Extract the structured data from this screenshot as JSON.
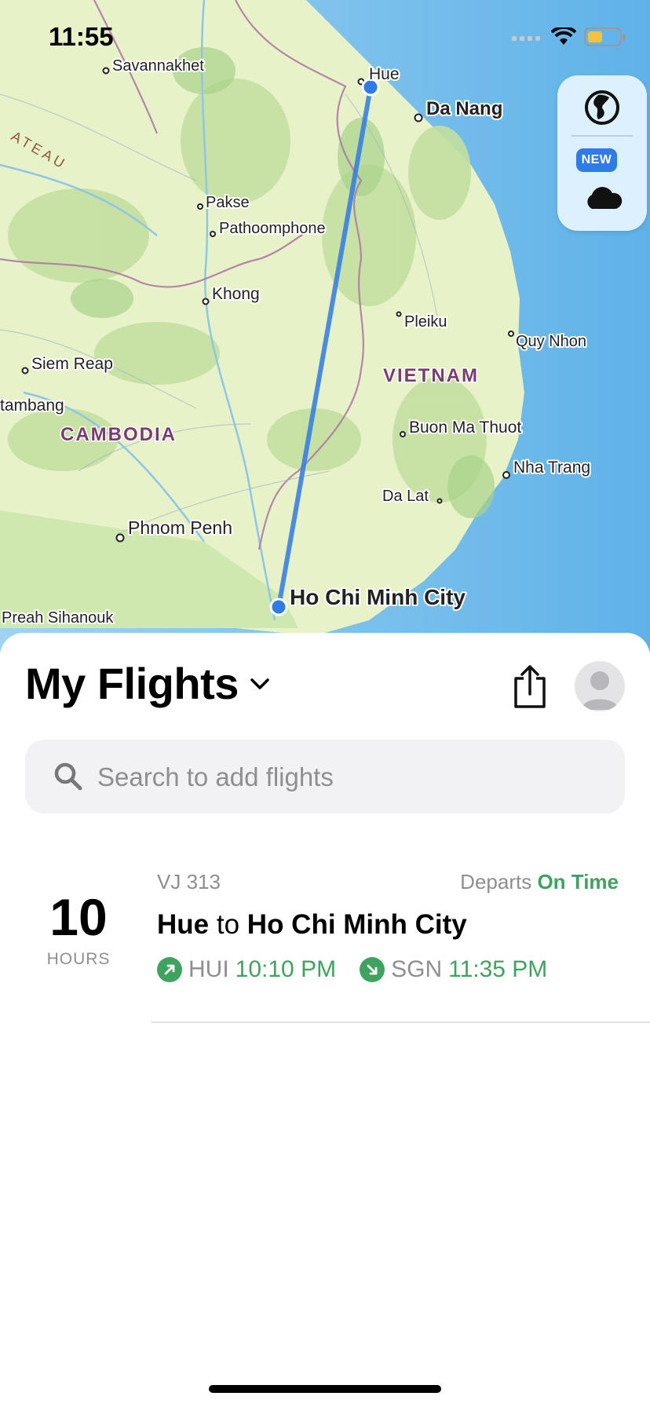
{
  "status_bar": {
    "time": "11:55"
  },
  "map": {
    "places": {
      "savannakhet": "Savannakhet",
      "hue": "Hue",
      "da_nang": "Da Nang",
      "pakse": "Pakse",
      "pathoomphone": "Pathoomphone",
      "khong": "Khong",
      "pleiku": "Pleiku",
      "quy_nhon": "Quy Nhon",
      "siem_reap": "Siem Reap",
      "battambang": "tambang",
      "buon_ma_thuot": "Buon Ma Thuot",
      "nha_trang": "Nha Trang",
      "da_lat": "Da Lat",
      "phnom_penh": "Phnom Penh",
      "ho_chi_minh": "Ho Chi Minh City",
      "preah_sihanouk": "Preah Sihanouk"
    },
    "regions": {
      "vietnam": "VIETNAM",
      "cambodia": "CAMBODIA",
      "plateau": "ATEAU"
    },
    "controls": {
      "new_badge": "NEW"
    }
  },
  "sheet": {
    "title": "My Flights",
    "search_placeholder": "Search to add flights"
  },
  "flights": [
    {
      "hours_value": "10",
      "hours_label": "HOURS",
      "flight_number": "VJ 313",
      "status_prefix": "Departs",
      "status": "On Time",
      "origin_city": "Hue",
      "connector": "to",
      "destination_city": "Ho Chi Minh City",
      "origin_code": "HUI",
      "departure_time": "10:10 PM",
      "destination_code": "SGN",
      "arrival_time": "11:35 PM"
    }
  ],
  "colors": {
    "accent_green": "#3fa35f",
    "route_blue": "#2f7be8",
    "ocean": "#7cc3ee",
    "land": "#e6f0c4"
  }
}
